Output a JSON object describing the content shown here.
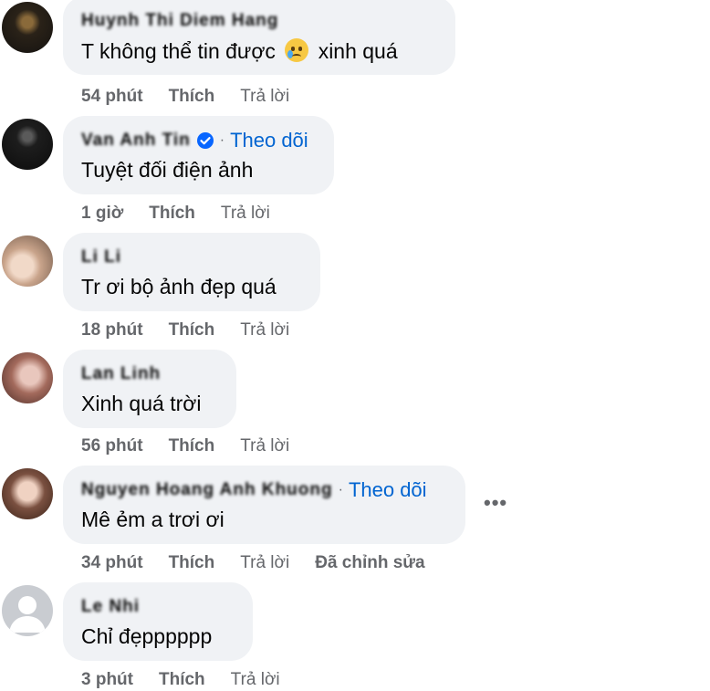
{
  "comments": [
    {
      "name": "Huynh Thi Diem Hang",
      "verified": false,
      "follow": "",
      "text": "T không thể tin được",
      "text_after": "xinh quá",
      "emoji": "face-holding-back-tears",
      "time": "54 phút",
      "like": "Thích",
      "reply": "Trả lời",
      "edited": ""
    },
    {
      "name": "Van Anh Tin",
      "verified": true,
      "follow": "Theo dõi",
      "text": "Tuyệt đối điện ảnh",
      "time": "1 giờ",
      "like": "Thích",
      "reply": "Trả lời",
      "edited": ""
    },
    {
      "name": "Li Li",
      "verified": false,
      "follow": "",
      "text": "Tr ơi bộ ảnh đẹp quá",
      "time": "18 phút",
      "like": "Thích",
      "reply": "Trả lời",
      "edited": ""
    },
    {
      "name": "Lan Linh",
      "verified": false,
      "follow": "",
      "text": "Xinh quá trời",
      "time": "56 phút",
      "like": "Thích",
      "reply": "Trả lời",
      "edited": ""
    },
    {
      "name": "Nguyen Hoang Anh Khuong",
      "verified": false,
      "follow": "Theo dõi",
      "text": "Mê ẻm a trơi ơi",
      "time": "34 phút",
      "like": "Thích",
      "reply": "Trả lời",
      "edited": "Đã chỉnh sửa"
    },
    {
      "name": "Le Nhi",
      "verified": false,
      "follow": "",
      "text": "Chỉ đẹpppppp",
      "time": "3 phút",
      "like": "Thích",
      "reply": "Trả lời",
      "edited": ""
    }
  ],
  "more_label": "•••",
  "colors": {
    "bubble": "#f0f2f5",
    "link": "#0064d1",
    "meta": "#65676b",
    "verified": "#0866ff"
  }
}
